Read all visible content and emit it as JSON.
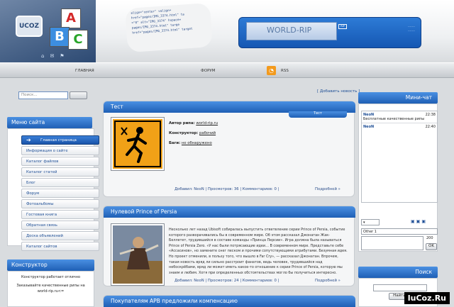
{
  "header": {
    "logo_text": "UCOZ",
    "cubes": [
      "A",
      "B",
      "C"
    ],
    "code_lines": [
      "align=\"center\" valign=",
      "href=\"pages/IMG_3374.html\" ta",
      "=\"0\" alt=\"IMG_3374\" hspace=",
      "pages/IMG_3374.html\" targe",
      "href=\"pages/IMG_3374.html\" target"
    ],
    "brand_text": "WORLD-RIP",
    "brand_small": "RIP",
    "brand_side": [
      "-------",
      "-------"
    ]
  },
  "nav": {
    "items": [
      "ГЛАВНАЯ",
      "ФОРУМ",
      "RSS"
    ]
  },
  "left": {
    "search_placeholder": "Поиск...",
    "menu_title": "Меню сайта",
    "menu_items": [
      "Главная страница",
      "Информация о сайте",
      "Каталог файлов",
      "Каталог статей",
      "Блог",
      "Форум",
      "Фотоальбомы",
      "Гостевая книга",
      "Обратная связь",
      "Доска объявлений",
      "Каталог сайтов"
    ],
    "constructor_title": "Конструктор",
    "constructor_text": "Конструктор работает отлично",
    "constructor_text2": "Заказывайте качественные рипы на world-rip.ru<="
  },
  "main": {
    "add_news": "[ Добавить новость ]",
    "posts": [
      {
        "title": "Тест",
        "tab": "Тест",
        "author_label": "Автор рипа:",
        "author_value": "world-rip.ru",
        "constructor_label": "Конструктор:",
        "constructor_value": "рабочий",
        "bugs_label": "Баги:",
        "bugs_value": "не обнаружено",
        "footer": "Добавил: NeoN | Просмотров: 36 | Комментариев: 0 |",
        "more": "Подробней »"
      },
      {
        "title": "Нулевой Prince of Persia",
        "text": "Несколько лет назад Ubisoft собиралась выпустить ответвление серии Prince of Persia, событие которого разворачивались бы в современном мире. Об этом рассказал Джонатан Жак-Беллетет, трудившийся в составе команды «Принца Персии». Игра должна была называться Prince of Persia Zero. «У нас были потрясающие идеи… В современном мире. Представьте себе «Ассасинов», но замените снег песком и прочими сопутствующими атрибутами. Безумная идея. Но проект отменили, в пользу того, что вышло в Far Cry», — рассказал Джонатан. Впрочем, такая новость вряд ли сильно расстроит фанатов, ведь человек, трудившийся над небоскрёбами, вряд ли может иметь какое-то отношение к серии Prince of Persia, которую мы знаем и любим. Хотя при определенных обстоятельствах могло бы получиться интересно.",
        "footer": "Добавил: NeoN | Просмотров: 24 | Комментариев: 0 |",
        "more": "Подробней »"
      },
      {
        "title": "Покупателям APB предложили компенсацию"
      }
    ]
  },
  "chat": {
    "title": "Мини-чат",
    "messages": [
      {
        "user": "NeoN",
        "time": "22:38",
        "text": "Бесплатные качественные рипы"
      },
      {
        "user": "NeoN",
        "time": "22:40",
        "text": ""
      }
    ],
    "name_value": "Other 1",
    "counter": "200",
    "ok_label": "OK"
  },
  "search": {
    "title": "Поиск",
    "button_label": "Найти"
  },
  "watermark": "IuCoz.Ru"
}
